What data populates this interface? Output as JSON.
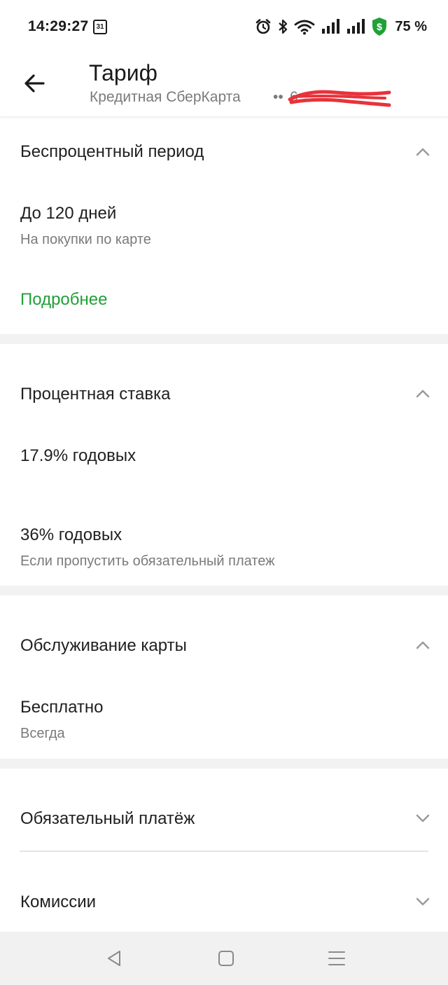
{
  "status_bar": {
    "time": "14:29:27",
    "calendar_day": "31",
    "battery": "75 %",
    "icons": [
      "alarm-icon",
      "bluetooth-icon",
      "wifi-icon",
      "signal-icon",
      "signal-icon",
      "security-shield-icon"
    ],
    "shield_color": "#21a038"
  },
  "header": {
    "title": "Тариф",
    "subtitle": "Кредитная СберКарта",
    "card_dots": "••",
    "card_number_masked": "6"
  },
  "sections": {
    "interest_free": {
      "title": "Беспроцентный период",
      "expanded": true,
      "item_main": "До 120 дней",
      "item_sub": "На покупки по карте",
      "link": "Подробнее"
    },
    "interest_rate": {
      "title": "Процентная ставка",
      "expanded": true,
      "item1_main": "17.9% годовых",
      "item2_main": "36% годовых",
      "item2_sub": "Если пропустить обязательный платеж"
    },
    "card_service": {
      "title": "Обслуживание карты",
      "expanded": true,
      "item_main": "Бесплатно",
      "item_sub": "Всегда"
    },
    "mandatory_payment": {
      "title": "Обязательный платёж",
      "expanded": false
    },
    "fees": {
      "title": "Комиссии",
      "expanded": false
    }
  },
  "colors": {
    "accent": "#21a038",
    "redaction": "#e8323a",
    "gap_bg": "#f2f2f2"
  }
}
